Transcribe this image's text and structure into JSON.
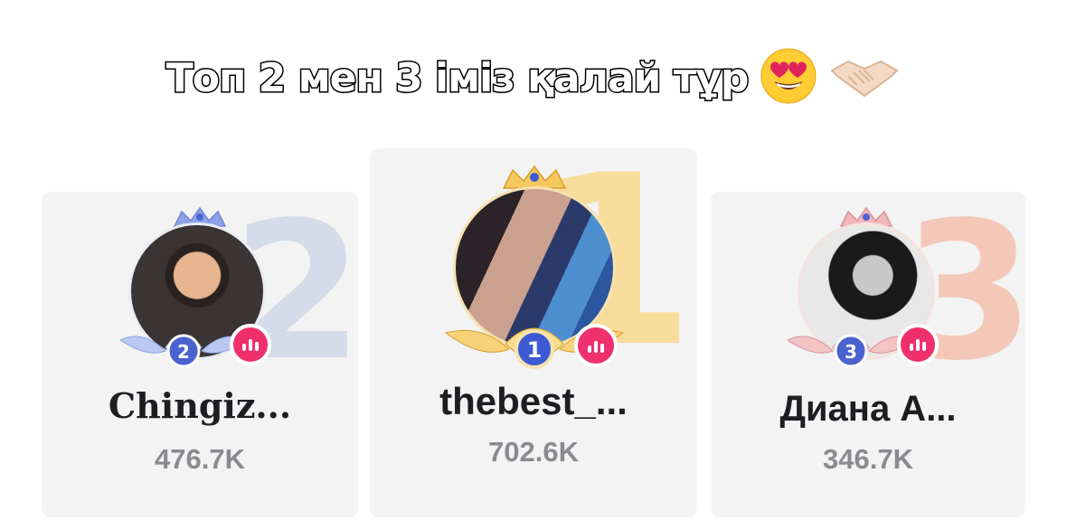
{
  "caption": {
    "text": "Топ 2 мен 3 іміз қалай тұр",
    "emojis": [
      "heart-eyes-icon",
      "handshake-icon"
    ]
  },
  "leaderboard": [
    {
      "rank": "2",
      "name": "Chingiz...",
      "score": "476.7K",
      "accent": "#5b6fd6",
      "number_color": "#d3dce8"
    },
    {
      "rank": "1",
      "name": "thebest_...",
      "score": "702.6K",
      "accent": "#f0b030",
      "number_color": "#f7dc9c"
    },
    {
      "rank": "3",
      "name": "Диана А...",
      "score": "346.7K",
      "accent": "#d8909a",
      "number_color": "#f3c8b8"
    }
  ],
  "live_badge_color": "#f0306e"
}
